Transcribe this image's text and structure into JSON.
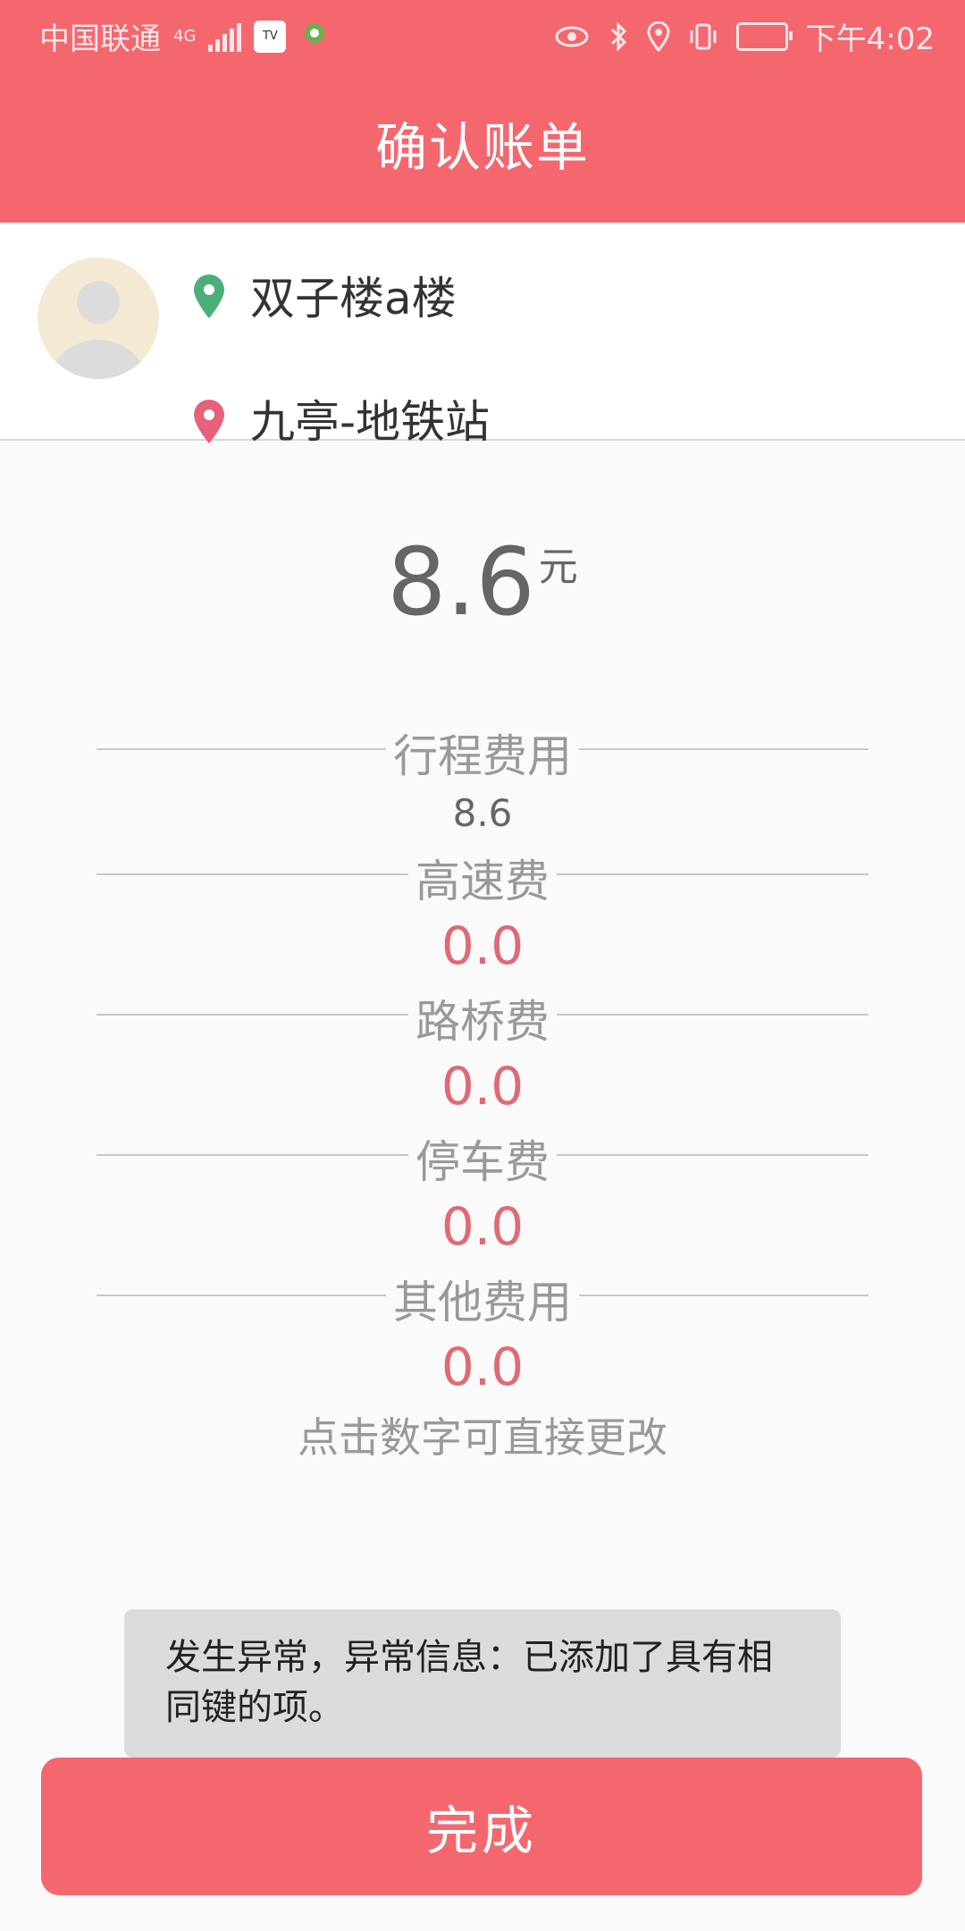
{
  "status_bar": {
    "carrier": "中国联通",
    "network": "4G",
    "time": "下午4:02"
  },
  "header": {
    "title": "确认账单"
  },
  "route": {
    "start": "双子楼a楼",
    "end": "九亭-地铁站"
  },
  "total": {
    "amount": "8.6",
    "unit": "元"
  },
  "fees": [
    {
      "label": "行程费用",
      "value": "8.6"
    },
    {
      "label": "高速费",
      "value": "0.0"
    },
    {
      "label": "路桥费",
      "value": "0.0"
    },
    {
      "label": "停车费",
      "value": "0.0"
    },
    {
      "label": "其他费用",
      "value": "0.0"
    }
  ],
  "hint": "点击数字可直接更改",
  "toast": {
    "message": "发生异常，异常信息：已添加了具有相同键的项。"
  },
  "finish_button": {
    "label": "完成"
  },
  "colors": {
    "primary": "#f5676e",
    "start_pin": "#4caf7a",
    "end_pin": "#e8607a",
    "fee_value": "#e06a73"
  }
}
